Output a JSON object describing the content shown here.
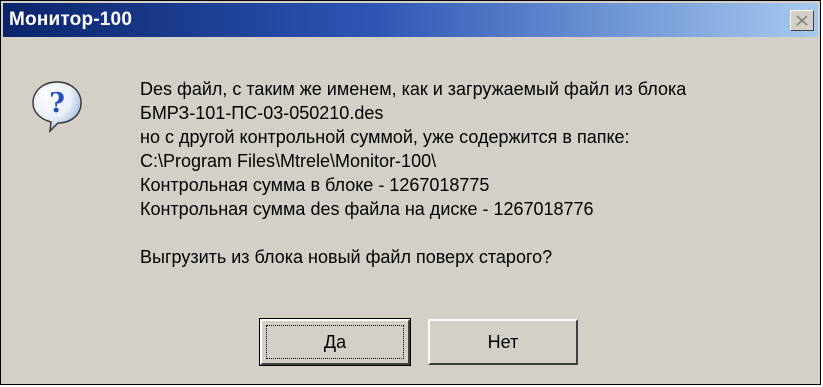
{
  "window": {
    "title": "Монитор-100",
    "close_label": "×"
  },
  "icon": {
    "name": "question-icon",
    "glyph": "?"
  },
  "message": {
    "lines": [
      "Des файл, с таким же именем, как и загружаемый файл из блока",
      "БМРЗ-101-ПС-03-050210.des",
      "но с другой контрольной суммой, уже содержится в папке:",
      "C:\\Program Files\\Mtrele\\Monitor-100\\",
      "Контрольная сумма в блоке - 1267018775",
      "Контрольная сумма des файла на диске - 1267018776"
    ],
    "question": "Выгрузить из блока новый файл поверх старого?"
  },
  "buttons": {
    "yes_label": "Да",
    "no_label": "Нет"
  },
  "colors": {
    "title_gradient_start": "#0a246a",
    "title_gradient_end": "#a6caf0",
    "face": "#d4d0c8",
    "icon_blue": "#1e4fc0"
  }
}
